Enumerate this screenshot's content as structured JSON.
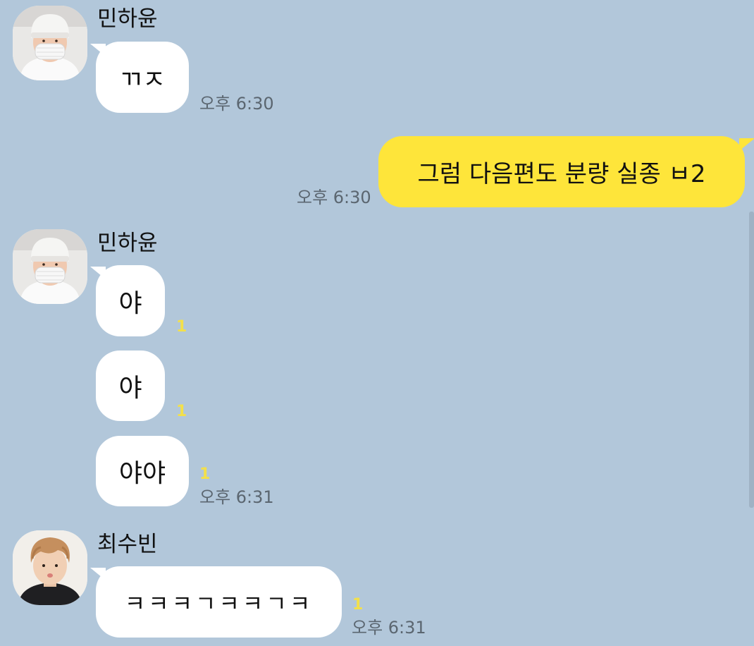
{
  "messages": [
    {
      "sender": "민하윤",
      "text": "ㄲㅈ",
      "time": "오후 6:30"
    },
    {
      "text": "그럼 다음편도 분량 실종 ㅂ2",
      "time": "오후 6:30"
    },
    {
      "sender": "민하윤",
      "texts": [
        "야",
        "야",
        "야야"
      ],
      "unread": [
        "1",
        "1",
        "1"
      ],
      "time": "오후 6:31"
    },
    {
      "sender": "최수빈",
      "text": "ㅋㅋㅋㄱㅋㅋㄱㅋ",
      "unread": "1",
      "time": "오후 6:31"
    }
  ],
  "colors": {
    "background": "#b2c7da",
    "my_bubble": "#fee53a",
    "their_bubble": "#ffffff",
    "unread": "#f3e04a"
  },
  "icons": {
    "avatar1": "profile-photo-masked-person",
    "avatar2": "profile-photo-masked-person",
    "avatar3": "profile-photo-person"
  }
}
